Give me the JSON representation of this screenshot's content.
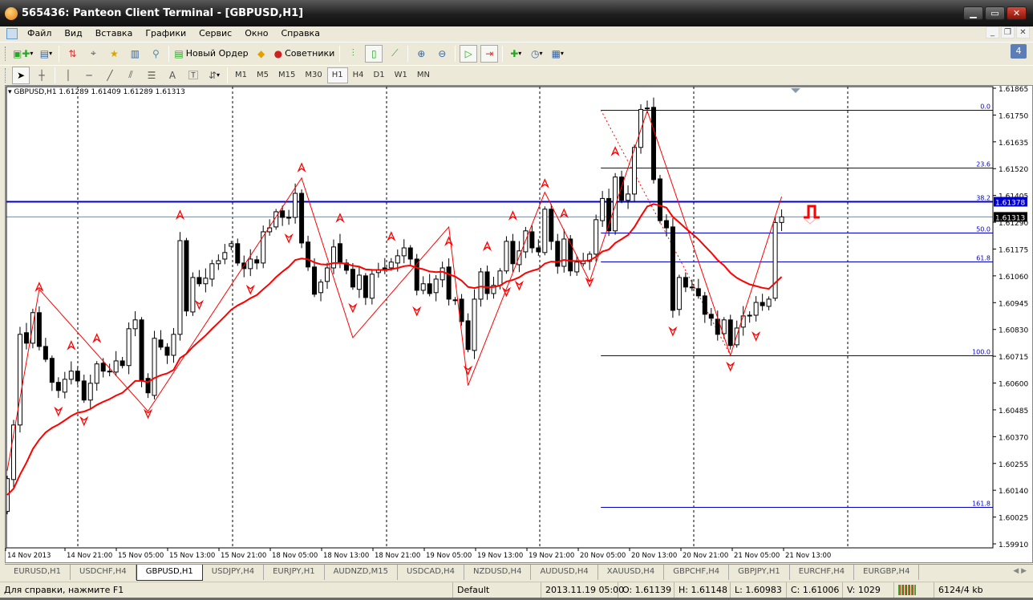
{
  "window": {
    "title": "565436: Panteon Client Terminal - [GBPUSD,H1]"
  },
  "menu": [
    "Файл",
    "Вид",
    "Вставка",
    "Графики",
    "Сервис",
    "Окно",
    "Справка"
  ],
  "toolbar": {
    "new_order": "Новый Ордер",
    "experts": "Советники"
  },
  "timeframes": [
    "M1",
    "M5",
    "M15",
    "M30",
    "H1",
    "H4",
    "D1",
    "W1",
    "MN"
  ],
  "active_timeframe": "H1",
  "messages_badge": "4",
  "chart_header": "GBPUSD,H1  1.61289 1.61409 1.61289 1.61313",
  "tabs": [
    "EURUSD,H1",
    "USDCHF,H4",
    "GBPUSD,H1",
    "USDJPY,H4",
    "EURJPY,H1",
    "AUDNZD,M15",
    "USDCAD,H4",
    "NZDUSD,H4",
    "AUDUSD,H4",
    "XAUUSD,H4",
    "GBPCHF,H4",
    "GBPJPY,H1",
    "EURCHF,H4",
    "EURGBP,H4"
  ],
  "active_tab": "GBPUSD,H1",
  "status": {
    "help": "Для справки, нажмите F1",
    "profile": "Default",
    "datetime": "2013.11.19 05:00",
    "open": "O: 1.61139",
    "high": "H: 1.61148",
    "low": "L: 1.60983",
    "close": "C: 1.61006",
    "volume": "V: 1029",
    "traffic": "6124/4 kb"
  },
  "chart_data": {
    "type": "candlestick",
    "symbol": "GBPUSD",
    "timeframe": "H1",
    "ylim": [
      1.5991,
      1.61865
    ],
    "price_ticks": [
      "1.61865",
      "1.61750",
      "1.61635",
      "1.61520",
      "1.61405",
      "1.61290",
      "1.61175",
      "1.61060",
      "1.60945",
      "1.60830",
      "1.60715",
      "1.60600",
      "1.60485",
      "1.60370",
      "1.60255",
      "1.60140",
      "1.60025",
      "1.59910"
    ],
    "time_labels": [
      "14 Nov 2013",
      "14 Nov 21:00",
      "15 Nov 05:00",
      "15 Nov 13:00",
      "15 Nov 21:00",
      "18 Nov 05:00",
      "18 Nov 13:00",
      "18 Nov 21:00",
      "19 Nov 05:00",
      "19 Nov 13:00",
      "19 Nov 21:00",
      "20 Nov 05:00",
      "20 Nov 13:00",
      "20 Nov 21:00",
      "21 Nov 05:00",
      "21 Nov 13:00"
    ],
    "candles_open_close": [
      [
        1.60049,
        1.6019
      ],
      [
        1.60186,
        1.6042
      ],
      [
        1.6042,
        1.60809
      ],
      [
        1.60816,
        1.60771
      ],
      [
        1.60771,
        1.60902
      ],
      [
        1.60902,
        1.60757
      ],
      [
        1.60757,
        1.60702
      ],
      [
        1.60706,
        1.60603
      ],
      [
        1.60603,
        1.60568
      ],
      [
        1.60561,
        1.60616
      ],
      [
        1.60616,
        1.60651
      ],
      [
        1.60651,
        1.60609
      ],
      [
        1.60609,
        1.60527
      ],
      [
        1.60527,
        1.60599
      ],
      [
        1.60599,
        1.60682
      ],
      [
        1.60685,
        1.60651
      ],
      [
        1.60651,
        1.60651
      ],
      [
        1.60647,
        1.60695
      ],
      [
        1.60695,
        1.60675
      ],
      [
        1.60675,
        1.60833
      ],
      [
        1.60833,
        1.60871
      ],
      [
        1.60871,
        1.60609
      ],
      [
        1.6062,
        1.60558
      ],
      [
        1.60547,
        1.60792
      ],
      [
        1.60785,
        1.60754
      ],
      [
        1.60754,
        1.60719
      ],
      [
        1.60719,
        1.60809
      ],
      [
        1.60809,
        1.61211
      ],
      [
        1.61211,
        1.60909
      ],
      [
        1.60905,
        1.61053
      ],
      [
        1.61053,
        1.61026
      ],
      [
        1.61026,
        1.6105
      ],
      [
        1.61046,
        1.61112
      ],
      [
        1.61112,
        1.61125
      ],
      [
        1.61132,
        1.6116
      ],
      [
        1.61187,
        1.61198
      ],
      [
        1.61198,
        1.61115
      ],
      [
        1.61115,
        1.61091
      ],
      [
        1.61091,
        1.61132
      ],
      [
        1.61129,
        1.61115
      ],
      [
        1.61115,
        1.61249
      ],
      [
        1.61249,
        1.61266
      ],
      [
        1.6127,
        1.61335
      ],
      [
        1.61339,
        1.61311
      ],
      [
        1.61311,
        1.61311
      ],
      [
        1.61311,
        1.61414
      ],
      [
        1.61414,
        1.61201
      ],
      [
        1.61205,
        1.61098
      ],
      [
        1.61098,
        1.60981
      ],
      [
        1.60988,
        1.61033
      ],
      [
        1.61036,
        1.61094
      ],
      [
        1.61094,
        1.61184
      ],
      [
        1.61198,
        1.61115
      ],
      [
        1.61115,
        1.61084
      ],
      [
        1.61088,
        1.61012
      ],
      [
        1.61002,
        1.61063
      ],
      [
        1.6106,
        1.60967
      ],
      [
        1.60964,
        1.61067
      ],
      [
        1.61074,
        1.61084
      ],
      [
        1.61094,
        1.61084
      ],
      [
        1.61094,
        1.61119
      ],
      [
        1.61115,
        1.61146
      ],
      [
        1.61146,
        1.6118
      ],
      [
        1.6118,
        1.61132
      ],
      [
        1.61132,
        1.60998
      ],
      [
        1.60998,
        1.61026
      ],
      [
        1.61026,
        1.60984
      ],
      [
        1.60988,
        1.61046
      ],
      [
        1.61043,
        1.61094
      ],
      [
        1.61098,
        1.6096
      ],
      [
        1.60957,
        1.60957
      ],
      [
        1.6096,
        1.60864
      ],
      [
        1.60867,
        1.60744
      ],
      [
        1.6074,
        1.6096
      ],
      [
        1.6096,
        1.61077
      ],
      [
        1.61077,
        1.60984
      ],
      [
        1.60984,
        1.61019
      ],
      [
        1.61019,
        1.61081
      ],
      [
        1.61081,
        1.61208
      ],
      [
        1.61208,
        1.61112
      ],
      [
        1.61108,
        1.61167
      ],
      [
        1.61163,
        1.61253
      ],
      [
        1.61249,
        1.6118
      ],
      [
        1.6118,
        1.61163
      ],
      [
        1.6116,
        1.61346
      ],
      [
        1.61346,
        1.61208
      ],
      [
        1.61208,
        1.61101
      ],
      [
        1.61101,
        1.61218
      ],
      [
        1.61218,
        1.61081
      ],
      [
        1.61077,
        1.61119
      ],
      [
        1.61112,
        1.61122
      ],
      [
        1.61122,
        1.61153
      ],
      [
        1.61153,
        1.61301
      ],
      [
        1.61297,
        1.61392
      ],
      [
        1.61392,
        1.61253
      ],
      [
        1.61253,
        1.61484
      ],
      [
        1.61484,
        1.61384
      ],
      [
        1.61384,
        1.61411
      ],
      [
        1.61411,
        1.61611
      ],
      [
        1.61611,
        1.61774
      ],
      [
        1.6178,
        1.6178
      ],
      [
        1.61783,
        1.61473
      ],
      [
        1.61476,
        1.61297
      ],
      [
        1.61297,
        1.61266
      ],
      [
        1.6127,
        1.60912
      ],
      [
        1.60916,
        1.61053
      ],
      [
        1.61053,
        1.61012
      ],
      [
        1.61012,
        1.61012
      ],
      [
        1.61005,
        1.60974
      ],
      [
        1.60974,
        1.60895
      ],
      [
        1.60895,
        1.60878
      ],
      [
        1.60874,
        1.60809
      ],
      [
        1.60812,
        1.60871
      ],
      [
        1.60871,
        1.60761
      ],
      [
        1.60764,
        1.60836
      ],
      [
        1.6084,
        1.60888
      ],
      [
        1.60891,
        1.60891
      ],
      [
        1.60891,
        1.60946
      ],
      [
        1.60946,
        1.60932
      ],
      [
        1.60929,
        1.6096
      ],
      [
        1.60964,
        1.61289
      ],
      [
        1.61289,
        1.61313
      ]
    ],
    "zigzag": [
      [
        0,
        1.60224
      ],
      [
        5,
        1.61002
      ],
      [
        22,
        1.60479
      ],
      [
        46,
        1.6148
      ],
      [
        54,
        1.60795
      ],
      [
        69,
        1.6127
      ],
      [
        72,
        1.60589
      ],
      [
        84,
        1.61419
      ],
      [
        91,
        1.61036
      ],
      [
        100,
        1.61768
      ],
      [
        113,
        1.60719
      ],
      [
        121,
        1.614
      ]
    ],
    "fractals_up": [
      5,
      10,
      14,
      27,
      46,
      52,
      60,
      69,
      75,
      79,
      84,
      87,
      95,
      100
    ],
    "fractals_down": [
      8,
      12,
      22,
      30,
      38,
      44,
      54,
      64,
      72,
      78,
      80,
      91,
      104,
      113,
      117
    ],
    "fibonacci": {
      "start_index": 93,
      "levels": [
        {
          "label": "0.0",
          "price": 1.61772
        },
        {
          "label": "23.6",
          "price": 1.61524
        },
        {
          "label": "38.2",
          "price": 1.61378
        },
        {
          "label": "50.0",
          "price": 1.61246
        },
        {
          "label": "61.8",
          "price": 1.61122
        },
        {
          "label": "100.0",
          "price": 1.60719
        },
        {
          "label": "161.8",
          "price": 1.60069
        }
      ],
      "trend": [
        [
          93,
          1.61772
        ],
        [
          113,
          1.60719
        ]
      ]
    },
    "hline": {
      "price": 1.61378,
      "label": "1.61378",
      "color": "#0000cc"
    },
    "bid": {
      "price": 1.61313,
      "label": "1.61313"
    },
    "ma_period": 21,
    "colors": {
      "ma": "#ff0000",
      "zigzag": "#ff0000",
      "fib": "#0000cc",
      "bull": "#ffffff",
      "bear": "#000000"
    }
  }
}
